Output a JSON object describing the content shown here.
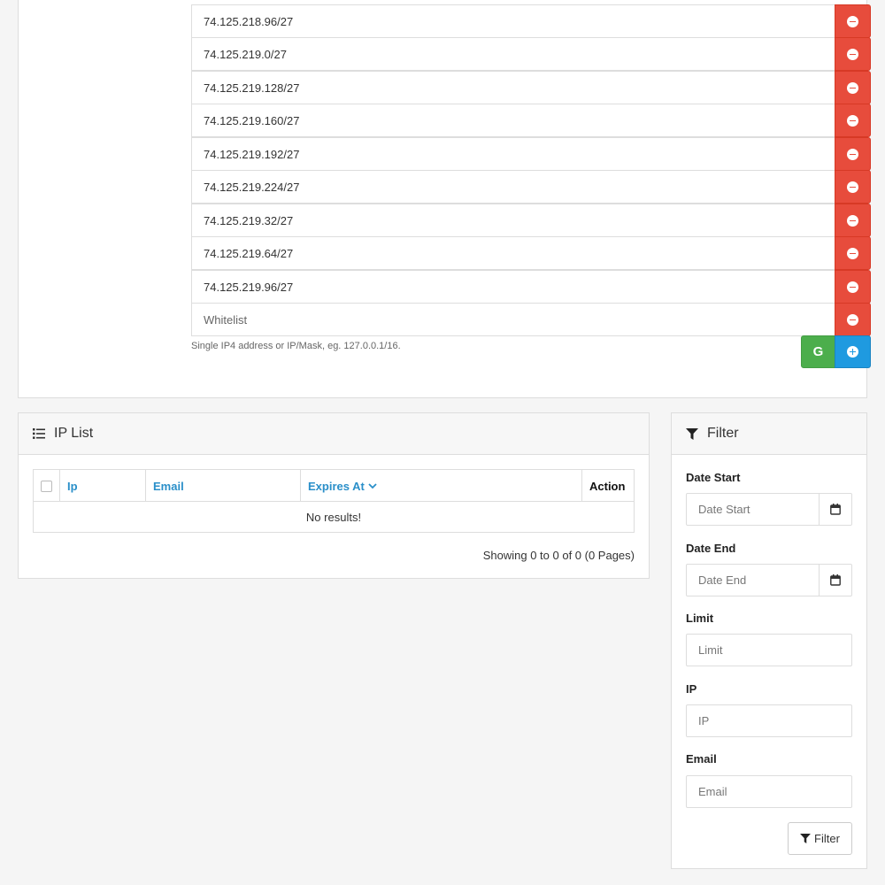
{
  "whitelist": {
    "entries": [
      "74.125.218.96/27",
      "74.125.219.0/27",
      "74.125.219.128/27",
      "74.125.219.160/27",
      "74.125.219.192/27",
      "74.125.219.224/27",
      "74.125.219.32/27",
      "74.125.219.64/27",
      "74.125.219.96/27"
    ],
    "placeholder": "Whitelist",
    "help": "Single IP4 address or IP/Mask, eg. 127.0.0.1/16.",
    "g_button_label": "G",
    "colors": {
      "remove": "#e74c3c",
      "g": "#4cae4c",
      "add": "#1f9ae0"
    }
  },
  "ip_list": {
    "title": "IP List",
    "columns": {
      "ip": "Ip",
      "email": "Email",
      "expires_at": "Expires At",
      "action": "Action"
    },
    "empty_text": "No results!",
    "showing": "Showing 0 to 0 of 0 (0 Pages)"
  },
  "filter": {
    "title": "Filter",
    "date_start": {
      "label": "Date Start",
      "placeholder": "Date Start"
    },
    "date_end": {
      "label": "Date End",
      "placeholder": "Date End"
    },
    "limit": {
      "label": "Limit",
      "placeholder": "Limit"
    },
    "ip": {
      "label": "IP",
      "placeholder": "IP"
    },
    "email": {
      "label": "Email",
      "placeholder": "Email"
    },
    "button_label": "Filter"
  },
  "icons": {
    "remove": "minus-circle-icon",
    "add": "plus-circle-icon",
    "list": "list-icon",
    "filter": "funnel-icon",
    "calendar": "calendar-icon",
    "sort": "chevron-down-icon"
  }
}
